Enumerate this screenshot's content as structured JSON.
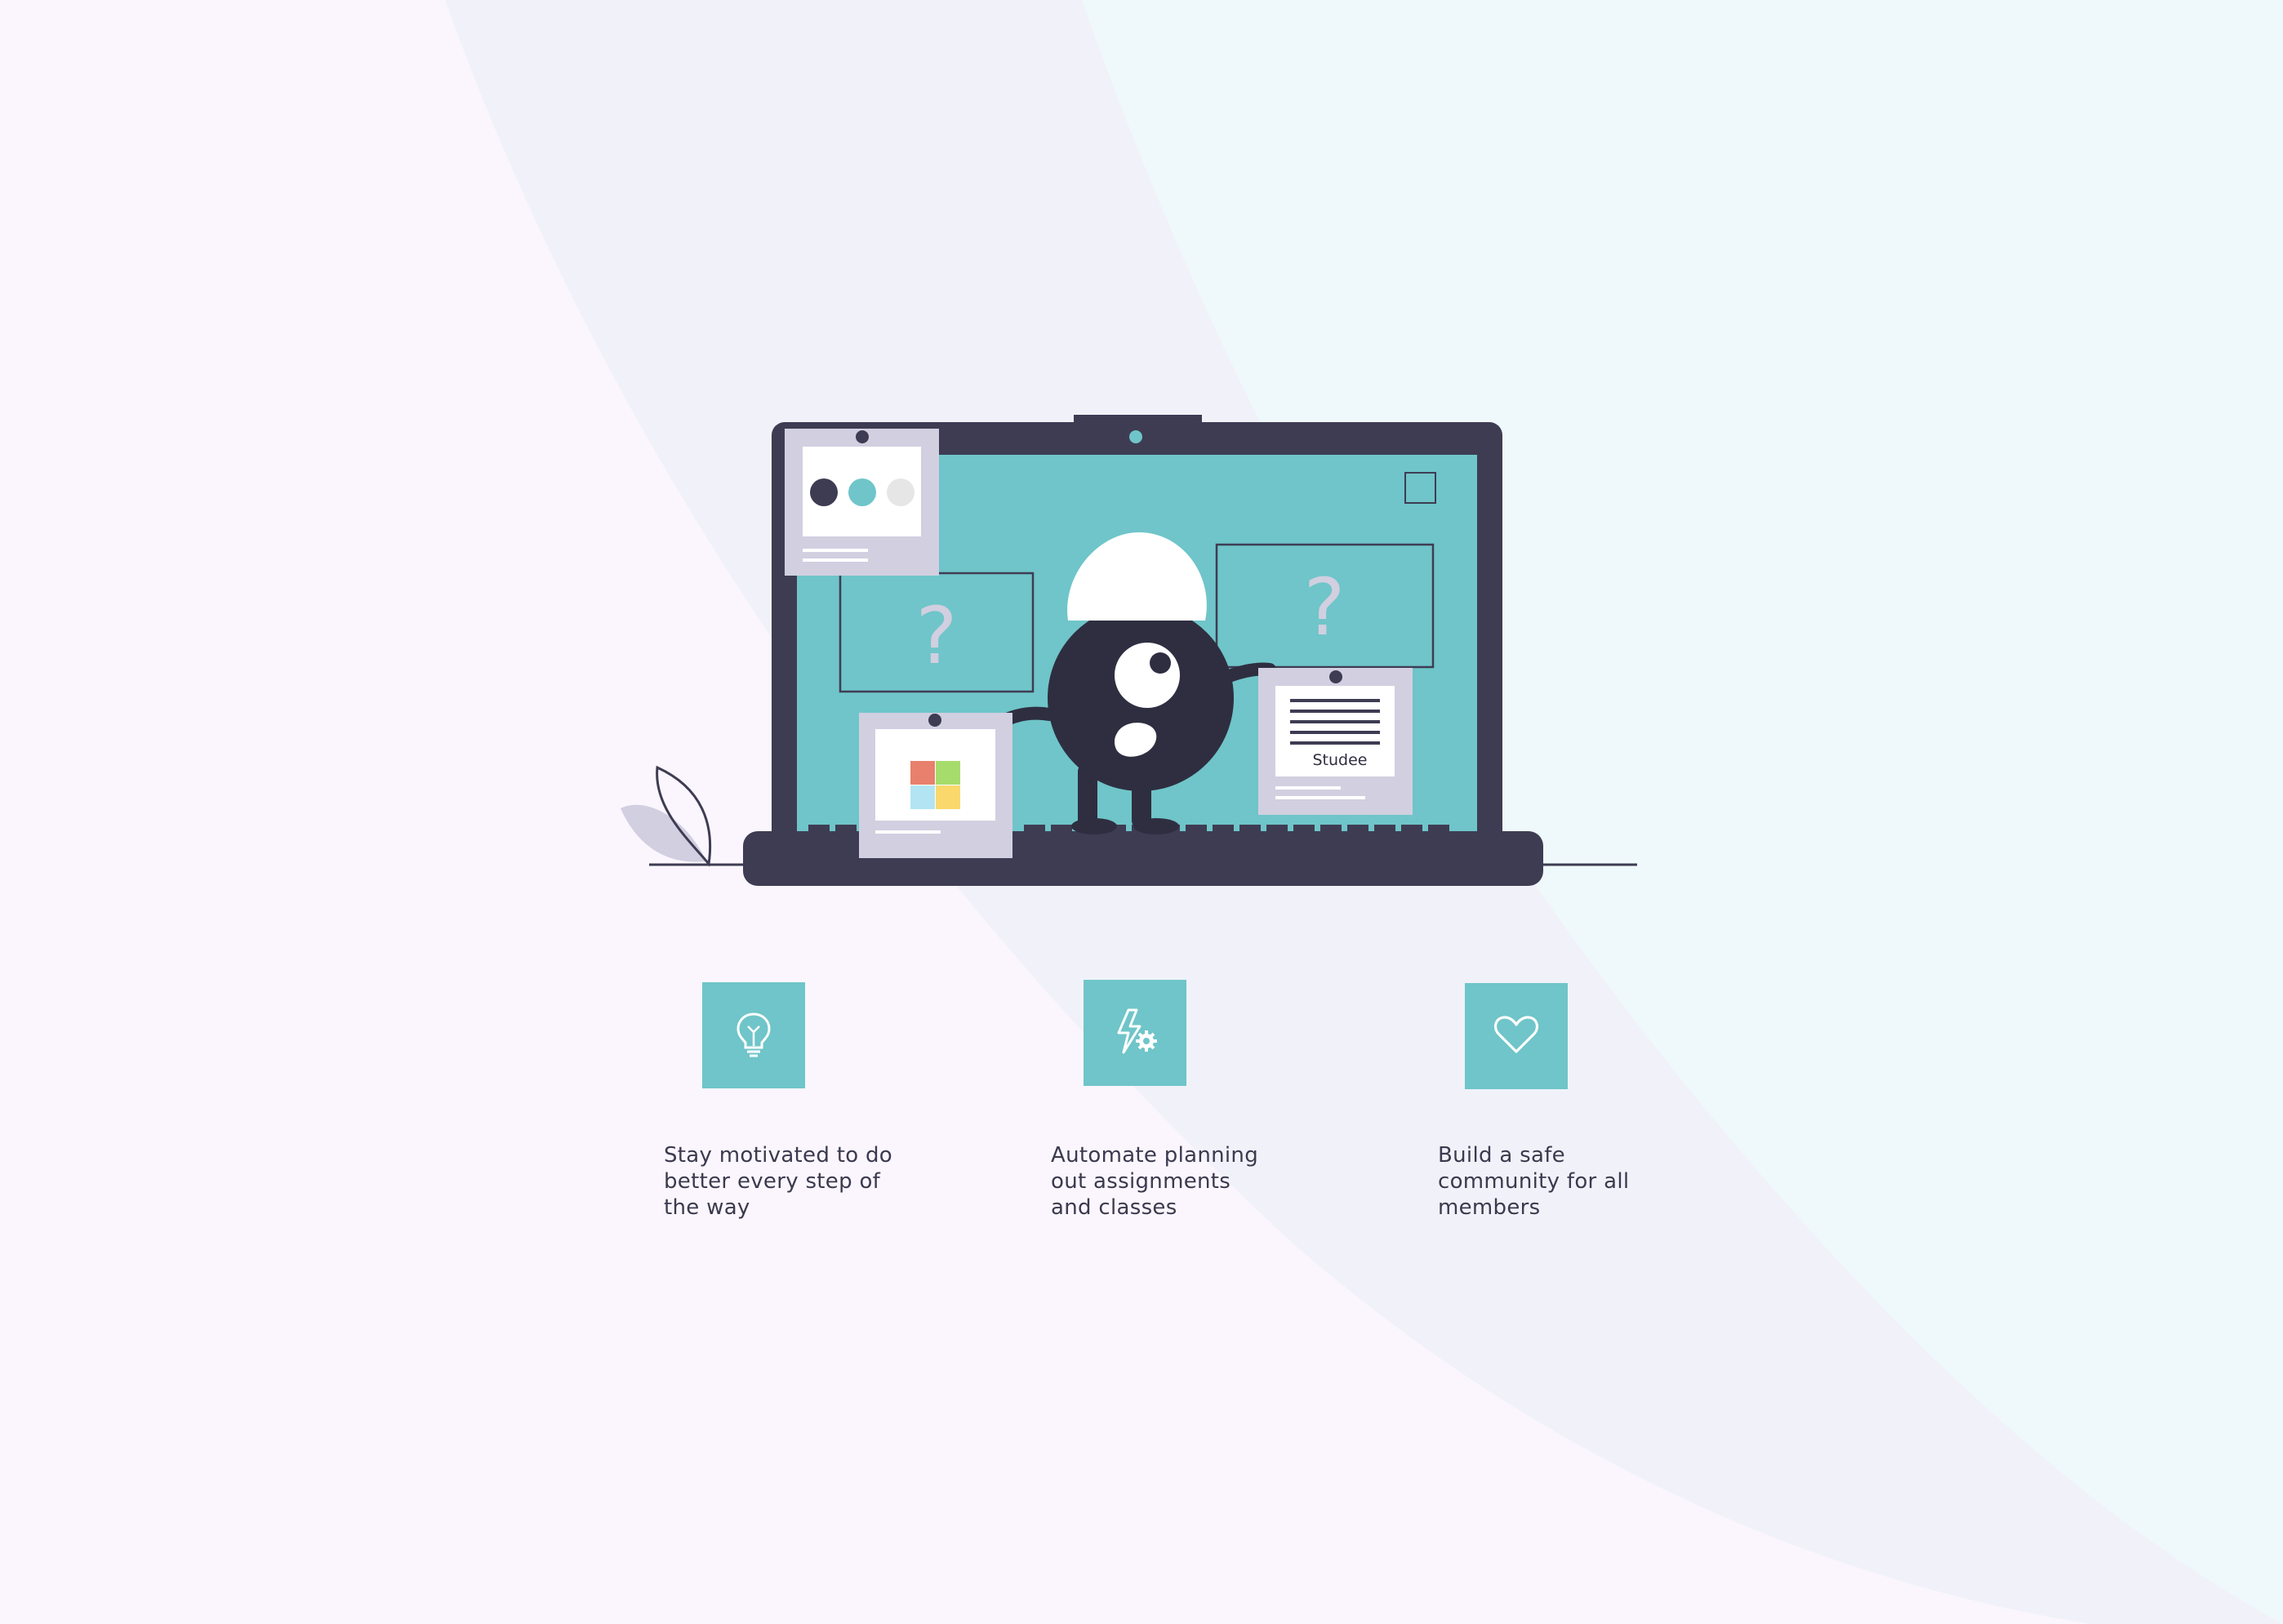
{
  "brand": {
    "accent": "#6fc5c9",
    "dark": "#3e3c53",
    "panel": "#d1cfe0",
    "background": "#fbf6fd"
  },
  "illustration": {
    "note_label": "Studee",
    "question_mark": "?",
    "color_tiles": [
      "#e8806d",
      "#a6dc6b",
      "#b3e4f3",
      "#fad86c"
    ],
    "dot_colors": [
      "#3e3c53",
      "#6fc5c9",
      "#e6e6e6"
    ]
  },
  "features": [
    {
      "icon": "lightbulb-icon",
      "text": "Stay motivated to do\nbetter every step of\nthe way"
    },
    {
      "icon": "lightning-gear-icon",
      "text": "Automate planning\nout assignments\nand classes"
    },
    {
      "icon": "heart-icon",
      "text": "Build a safe\ncommunity for all\nmembers"
    }
  ]
}
